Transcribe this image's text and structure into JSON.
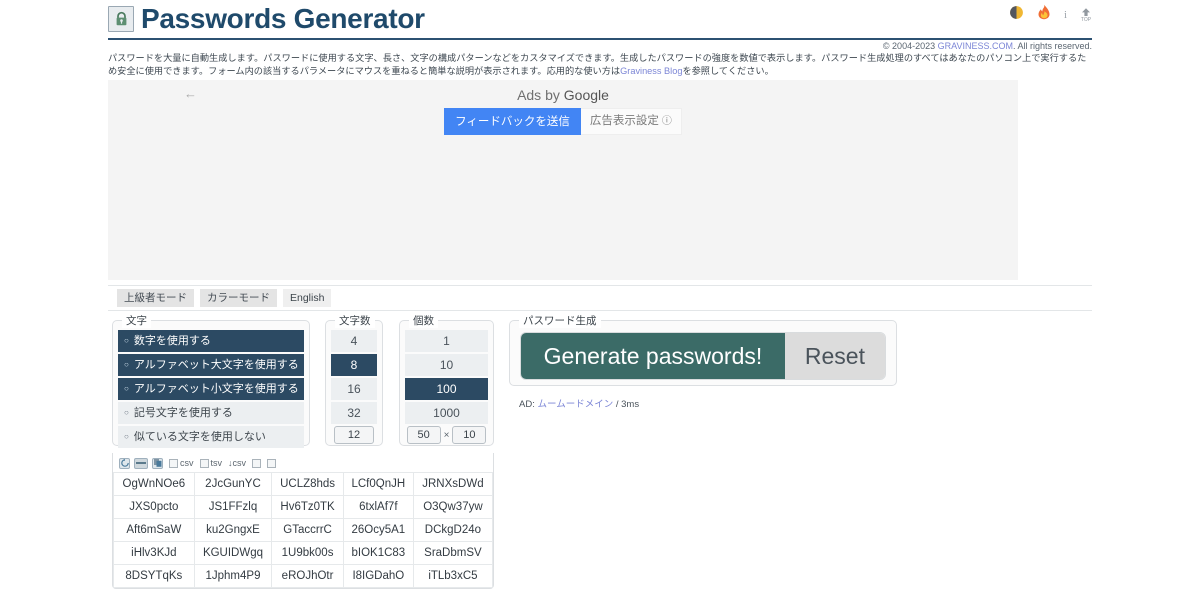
{
  "header": {
    "title": "Passwords Generator",
    "lock_icon": "lock-icon",
    "icons": [
      {
        "name": "dark-mode-icon",
        "label": ""
      },
      {
        "name": "flame-icon",
        "label": ""
      },
      {
        "name": "info-icon",
        "label": "i"
      },
      {
        "name": "scroll-top-icon",
        "label": "TOP"
      }
    ],
    "copyright_pre": "© 2004-2023 ",
    "copyright_link": "GRAVINESS.COM",
    "copyright_post": ". All rights reserved.",
    "description_1": "パスワードを大量に自動生成します。パスワードに使用する文字、長さ、文字の構成パターンなどをカスタマイズできます。生成したパスワードの強度を数値で表示します。パスワード生成処理のすべてはあなたのパソコン上で実行するため安全に使用できます。フォーム内の該当するパラメータにマウスを重ねる",
    "description_2_pre": "と簡単な説明が表示されます。応用的な使い方は",
    "description_2_link": "Graviness Blog",
    "description_2_post": "を参照してください。"
  },
  "ads": {
    "back_arrow": "←",
    "ads_by": "Ads by ",
    "google": "Google",
    "feedback_label": "フィードバックを送信",
    "settings_label": "広告表示設定",
    "settings_info": "ⓘ"
  },
  "modes": {
    "advanced": "上級者モード",
    "color": "カラーモード",
    "english": "English"
  },
  "characters": {
    "legend": "文字",
    "options": [
      {
        "label": "数字を使用する",
        "selected": true
      },
      {
        "label": "アルファベット大文字を使用する",
        "selected": true
      },
      {
        "label": "アルファベット小文字を使用する",
        "selected": true
      },
      {
        "label": "記号文字を使用する",
        "selected": false
      },
      {
        "label": "似ている文字を使用しない",
        "selected": false
      }
    ]
  },
  "length": {
    "legend": "文字数",
    "values": [
      {
        "label": "4",
        "selected": false
      },
      {
        "label": "8",
        "selected": true
      },
      {
        "label": "16",
        "selected": false
      },
      {
        "label": "32",
        "selected": false
      }
    ],
    "custom_value": "12"
  },
  "count": {
    "legend": "個数",
    "values": [
      {
        "label": "1",
        "selected": false
      },
      {
        "label": "10",
        "selected": false
      },
      {
        "label": "100",
        "selected": true
      },
      {
        "label": "1000",
        "selected": false
      }
    ],
    "rows_value": "50",
    "multiply_sign": "×",
    "cols_value": "10"
  },
  "generate": {
    "legend": "パスワード生成",
    "generate_label": "Generate passwords!",
    "reset_label": "Reset",
    "ad_prefix": "AD: ",
    "ad_link": "ムームードメイン",
    "ad_time": " / 3ms"
  },
  "results": {
    "toolbar": {
      "buttons": [
        {
          "name": "refresh-icon"
        },
        {
          "name": "separator-icon"
        },
        {
          "name": "copy-icon"
        }
      ],
      "checkboxes": [
        {
          "label": "csv",
          "checked": false
        },
        {
          "label": "tsv",
          "checked": false
        },
        {
          "label": "↓csv",
          "checked": false
        },
        {
          "label": "",
          "checked": false
        },
        {
          "label": "",
          "checked": false
        }
      ]
    },
    "rows": [
      [
        "OgWnNOe6",
        "2JcGunYC",
        "UCLZ8hds",
        "LCf0QnJH",
        "JRNXsDWd"
      ],
      [
        "JXS0pcto",
        "JS1FFzlq",
        "Hv6Tz0TK",
        "6txlAf7f",
        "O3Qw37yw"
      ],
      [
        "Aft6mSaW",
        "ku2GngxE",
        "GTaccrrC",
        "26Ocy5A1",
        "DCkgD24o"
      ],
      [
        "iHlv3KJd",
        "KGUIDWgq",
        "1U9bk00s",
        "bIOK1C83",
        "SraDbmSV"
      ],
      [
        "8DSYTqKs",
        "1Jphm4P9",
        "eROJhOtr",
        "I8IGDahO",
        "iTLb3xC5"
      ]
    ]
  },
  "colors": {
    "title": "#1f4a6b",
    "selected": "#2c4a63",
    "generate": "#3b6b67",
    "link": "#7c86d6",
    "ad_blue": "#4285f4"
  }
}
